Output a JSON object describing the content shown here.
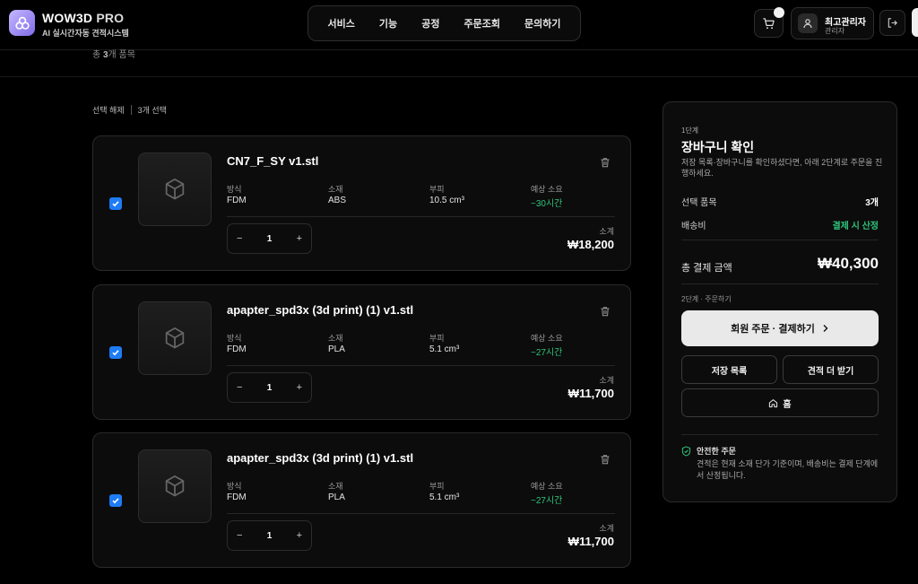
{
  "brand": {
    "name": "WOW3D",
    "suffix": "PRO",
    "tagline": "AI 실시간자동 견적시스템",
    "accent": "#8f7cf0"
  },
  "nav": {
    "items": [
      "서비스",
      "기능",
      "공정",
      "주문조회",
      "문의하기"
    ]
  },
  "user": {
    "name": "최고관리자",
    "role": "관리자"
  },
  "cart_summary": {
    "prefix": "총",
    "count": "3",
    "suffix": "개 품목"
  },
  "selection": {
    "deselect": "선택 해제",
    "selected": "3개 선택"
  },
  "labels": {
    "method": "방식",
    "material": "소재",
    "volume": "부피",
    "time": "예상 소요",
    "subtotal": "소계"
  },
  "items": [
    {
      "name": "CN7_F_SY v1.stl",
      "method": "FDM",
      "material": "ABS",
      "volume": "10.5 cm³",
      "time": "~30시간",
      "qty": "1",
      "subtotal": "₩18,200",
      "checked": true
    },
    {
      "name": "apapter_spd3x (3d print) (1) v1.stl",
      "method": "FDM",
      "material": "PLA",
      "volume": "5.1 cm³",
      "time": "~27시간",
      "qty": "1",
      "subtotal": "₩11,700",
      "checked": true
    },
    {
      "name": "apapter_spd3x (3d print) (1) v1.stl",
      "method": "FDM",
      "material": "PLA",
      "volume": "5.1 cm³",
      "time": "~27시간",
      "qty": "1",
      "subtotal": "₩11,700",
      "checked": true
    }
  ],
  "panel": {
    "step": "1단계",
    "title": "장바구니 확인",
    "description": "저장 목록·장바구니를 확인하셨다면, 아래 2단계로 주문을 진행하세요.",
    "selected_label": "선택 품목",
    "selected_value": "3개",
    "shipping_label": "배송비",
    "shipping_value": "결제 시 산정",
    "total_label": "총 결제 금액",
    "total_value": "₩40,300",
    "step2": "2단계 · 주문하기",
    "checkout_button": "회원 주문 · 결제하기",
    "saved_list_button": "저장 목록",
    "more_quote_button": "견적 더 받기",
    "home_button": "홈",
    "safe_title": "안전한 주문",
    "safe_desc": "견적은 현재 소재 단가 기준이며, 배송비는 결제 단계에서 산정됩니다."
  },
  "colors": {
    "background": "#000000",
    "checkbox": "#1e7cf5",
    "green": "#2ec37a",
    "primary_button": "#e9e9e9"
  }
}
